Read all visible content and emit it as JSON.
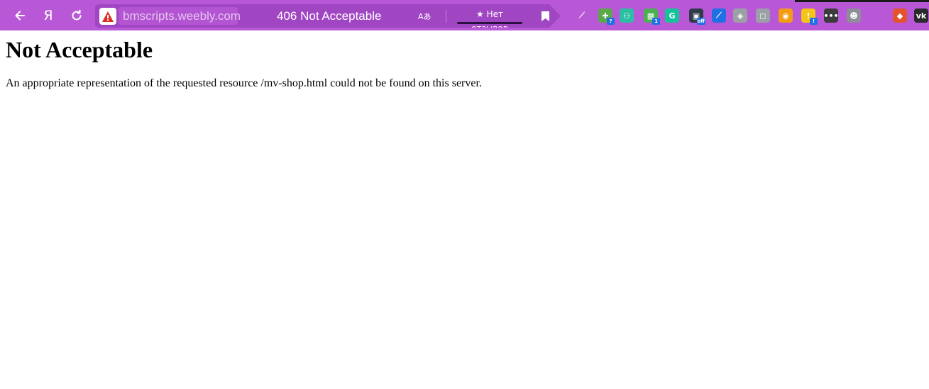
{
  "browser": {
    "toolbar_color": "#b858d6",
    "back_icon": "arrow-left-icon",
    "home_label": "Я",
    "reload_icon": "reload-icon",
    "security": {
      "icon": "warning-icon",
      "color": "#d93025"
    },
    "domain": "bmscripts.weebly.com",
    "tab_title": "406 Not Acceptable",
    "translate_label": "Aあ",
    "reviews_label": "★ Нет отзывов",
    "bookmark_icon": "bookmark-icon",
    "extensions": [
      {
        "name": "feather-icon",
        "glyph": "⟋",
        "color": "#b858d6"
      },
      {
        "name": "puzzle-extension-icon",
        "glyph": "✚",
        "color": "#5aa84a",
        "badge": "?"
      },
      {
        "name": "lightbulb-extension-icon",
        "glyph": "⚇",
        "color": "#2bbfa4"
      },
      {
        "name": "checker-extension-icon",
        "glyph": "▦",
        "color": "#4caf50",
        "badge": "1"
      },
      {
        "name": "grammarly-icon",
        "glyph": "G",
        "color": "#15c39a"
      },
      {
        "name": "calendar-off-icon",
        "glyph": "▣",
        "color": "#2f3a4a",
        "badge": "off"
      },
      {
        "name": "eyedropper-icon",
        "glyph": "⟋",
        "color": "#1f6fe5"
      },
      {
        "name": "cube-icon",
        "glyph": "◈",
        "color": "#9aa0a6"
      },
      {
        "name": "gray-square-icon",
        "glyph": "◻",
        "color": "#9aa0a6"
      },
      {
        "name": "orange-ring-icon",
        "glyph": "◉",
        "color": "#f29c13"
      },
      {
        "name": "yellow-extension-icon",
        "glyph": "!",
        "color": "#f5c518",
        "badge": "!"
      },
      {
        "name": "dots-extension-icon",
        "glyph": "•••",
        "color": "#3b3b3b"
      },
      {
        "name": "raccoon-icon",
        "glyph": "☻",
        "color": "#8e8e99"
      },
      {
        "name": "shield-extension-icon",
        "glyph": "◆",
        "color": "#e5532d"
      },
      {
        "name": "vk-icon",
        "glyph": "vk",
        "color": "#2a2a2a"
      }
    ]
  },
  "page": {
    "heading": "Not Acceptable",
    "message": "An appropriate representation of the requested resource /mv-shop.html could not be found on this server."
  }
}
